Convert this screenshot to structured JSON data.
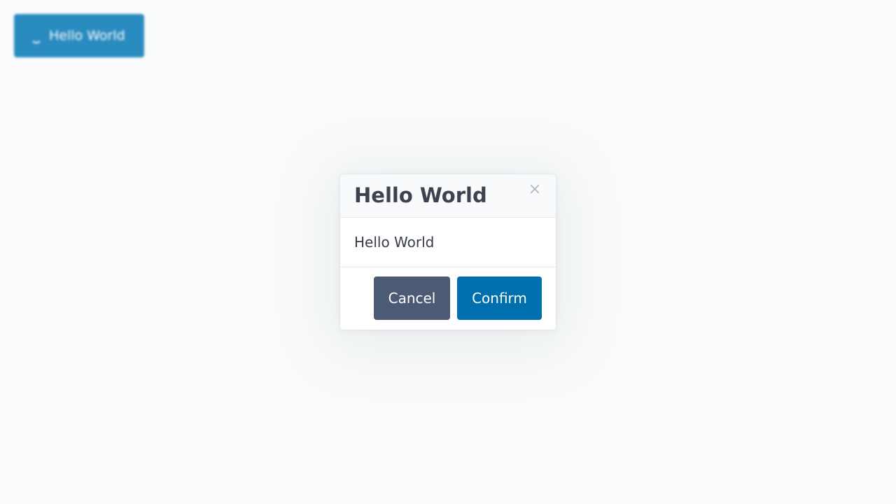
{
  "background_button": {
    "label": "Hello World",
    "icon": "spinner-icon",
    "color": "#1f86bd"
  },
  "modal": {
    "title": "Hello World",
    "close_symbol": "×",
    "body_text": "Hello World",
    "cancel_label": "Cancel",
    "confirm_label": "Confirm",
    "cancel_color": "#4c5a75",
    "confirm_color": "#006fad"
  }
}
